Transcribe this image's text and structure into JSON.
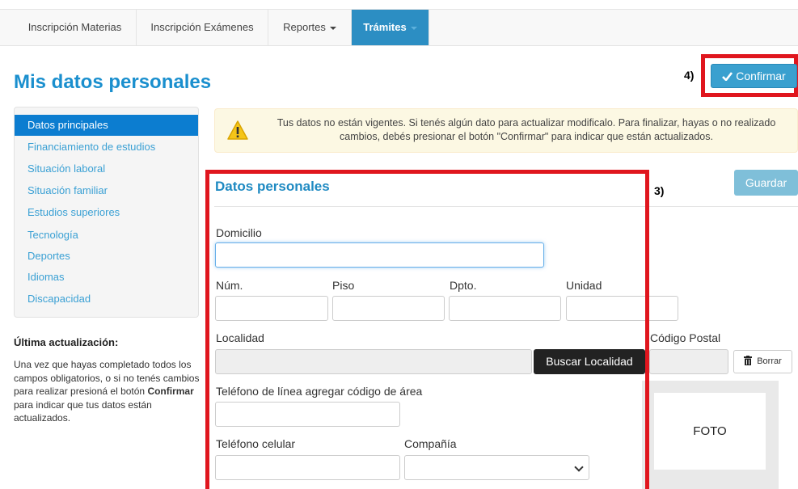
{
  "nav": {
    "tabs": [
      {
        "label": "Inscripción Materias"
      },
      {
        "label": "Inscripción Exámenes"
      },
      {
        "label": "Reportes"
      },
      {
        "label": "Trámites"
      }
    ]
  },
  "page_title": "Mis datos personales",
  "confirm": {
    "label": "Confirmar",
    "step": "4)"
  },
  "sidebar": {
    "items": [
      {
        "label": "Datos principales"
      },
      {
        "label": "Financiamiento de estudios"
      },
      {
        "label": "Situación laboral"
      },
      {
        "label": "Situación familiar"
      },
      {
        "label": "Estudios superiores"
      },
      {
        "label": "Tecnología"
      },
      {
        "label": "Deportes"
      },
      {
        "label": "Idiomas"
      },
      {
        "label": "Discapacidad"
      }
    ]
  },
  "last_update": {
    "title": "Última actualización:",
    "text_before": "Una vez que hayas completado todos los campos obligatorios, o si no tenés cambios para realizar presioná el botón ",
    "text_bold": "Confirmar",
    "text_after": " para indicar que tus datos están actualizados."
  },
  "alert": {
    "text": "Tus datos no están vigentes. Si tenés algún dato para actualizar modificalo. Para finalizar, hayas o no realizado cambios, debés presionar el botón \"Confirmar\" para indicar que están actualizados."
  },
  "save_label": "Guardar",
  "section": {
    "title": "Datos personales",
    "step": "3)"
  },
  "form": {
    "domicilio_label": "Domicilio",
    "domicilio_value": "",
    "num_label": "Núm.",
    "piso_label": "Piso",
    "dpto_label": "Dpto.",
    "unidad_label": "Unidad",
    "localidad_label": "Localidad",
    "buscar_localidad_label": "Buscar Localidad",
    "codigo_postal_label": "Código Postal",
    "borrar_label": "Borrar",
    "telefono_linea_label": "Teléfono de línea agregar código de área",
    "telefono_celular_label": "Teléfono celular",
    "compania_label": "Compañía",
    "compania_value": ""
  },
  "photo_label": "FOTO",
  "colors": {
    "brand": "#1a8fce",
    "active_nav": "#2c8ec3",
    "highlight": "#e0161e"
  }
}
